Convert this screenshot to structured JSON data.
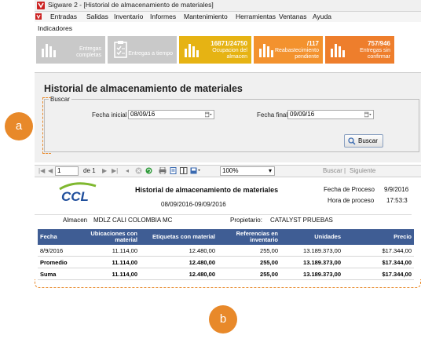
{
  "window": {
    "title": "Sigware 2 - [Historial de almacenamiento de materiales]"
  },
  "menu": [
    "Entradas",
    "Salidas",
    "Inventario",
    "Informes",
    "Mantenimiento",
    "Herramientas",
    "Ventanas",
    "Ayuda"
  ],
  "toolbar": {
    "indicadores": "Indicadores"
  },
  "tiles": [
    {
      "number": "",
      "label1": "Entregas",
      "label2": "completas",
      "color": "#c9c9c9",
      "icon": "bar-chart-icon"
    },
    {
      "number": "",
      "label1": "Entregas a tiempo",
      "label2": "",
      "color": "#c9c9c9",
      "icon": "clipboard-icon"
    },
    {
      "number": "16871/24750",
      "label1": "Ocupacion del",
      "label2": "almacen",
      "color": "#e6b313",
      "icon": "bar-chart-icon"
    },
    {
      "number": "/117",
      "label1": "Reabastecimiento",
      "label2": "pendiente",
      "color": "#f3922e",
      "icon": "bar-chart-icon"
    },
    {
      "number": "757/946",
      "label1": "Entregas sin",
      "label2": "confirmar",
      "color": "#ee7e2c",
      "icon": "bar-chart-icon"
    }
  ],
  "page": {
    "heading": "Historial de almacenamiento de materiales"
  },
  "search": {
    "legend": "Buscar",
    "fecha_inicial_label": "Fecha inicial",
    "fecha_inicial_value": "08/09/16",
    "fecha_final_label": "Fecha final",
    "fecha_final_value": "09/09/16",
    "button": "Buscar"
  },
  "report_toolbar": {
    "page_value": "1",
    "page_of": "de 1",
    "zoom": "100%",
    "find": "Buscar",
    "next": "Siguiente"
  },
  "report": {
    "logo": "CCL",
    "title": "Historial de almacenamiento de materiales",
    "range": "08/09/2016-09/09/2016",
    "fecha_proceso_label": "Fecha de Proceso",
    "fecha_proceso_value": "9/9/2016",
    "hora_proceso_label": "Hora de proceso",
    "hora_proceso_value": "17:53:3",
    "almacen_label": "Almacen",
    "almacen_value": "MDLZ CALI COLOMBIA MC",
    "propietario_label": "Propietario:",
    "propietario_value": "CATALYST PRUEBAS",
    "columns": [
      "Fecha",
      "Ubicaciones con material",
      "Etiquetas con material",
      "Referencias en inventario",
      "Unidades",
      "Precio"
    ],
    "rows": [
      [
        "8/9/2016",
        "11.114,00",
        "12.480,00",
        "255,00",
        "13.189.373,00",
        "$17.344,00"
      ],
      [
        "Promedio",
        "11.114,00",
        "12.480,00",
        "255,00",
        "13.189.373,00",
        "$17.344,00"
      ],
      [
        "Suma",
        "11.114,00",
        "12.480,00",
        "255,00",
        "13.189.373,00",
        "$17.344,00"
      ]
    ]
  },
  "annotations": {
    "a": "a",
    "b": "b",
    "color": "#e8892a"
  }
}
